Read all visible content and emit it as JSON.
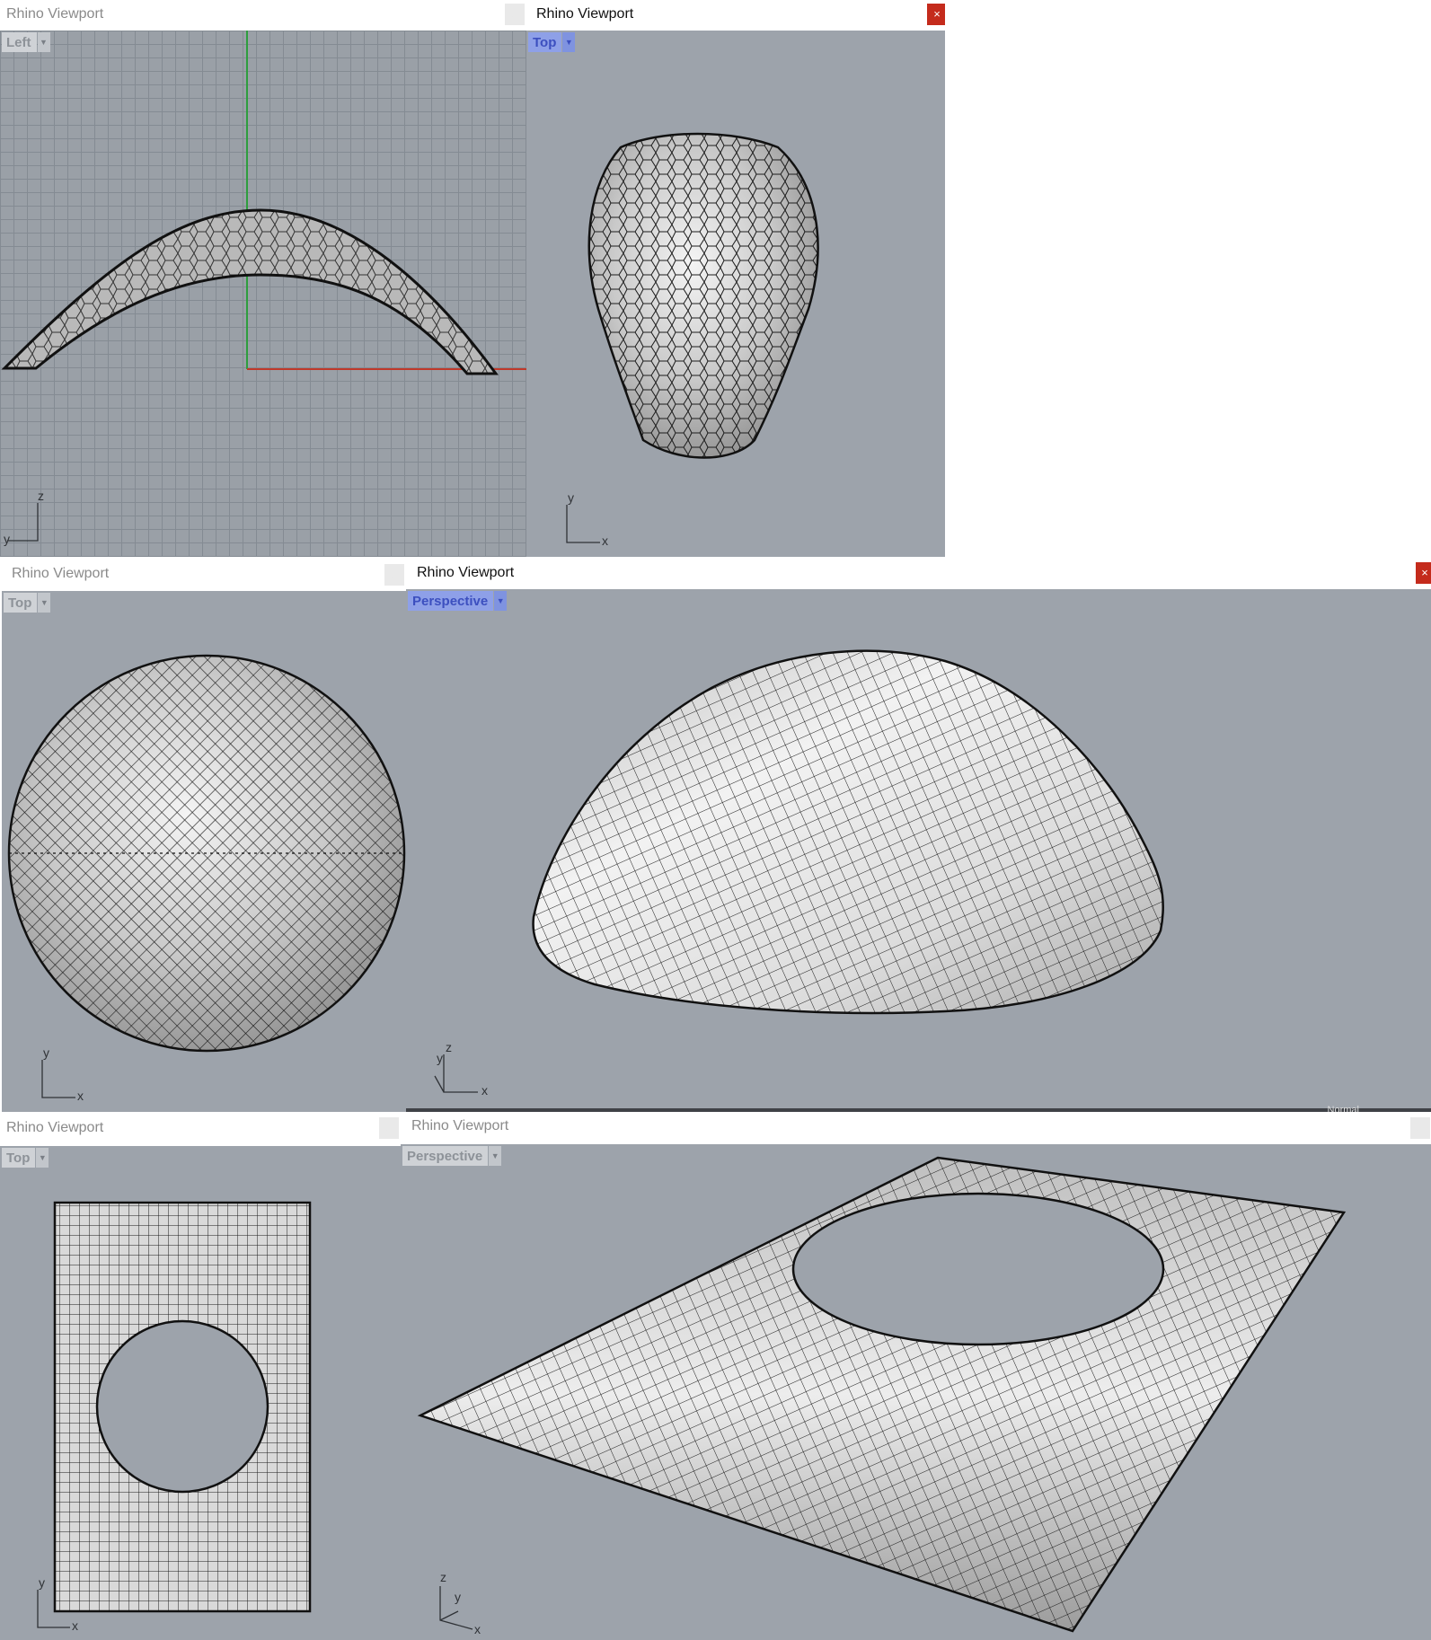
{
  "windows": [
    {
      "title": "Rhino Viewport",
      "view": "Left",
      "active": false,
      "axis": [
        "z",
        "y"
      ]
    },
    {
      "title": "Rhino Viewport",
      "view": "Top",
      "active": true,
      "axis": [
        "y",
        "x"
      ]
    },
    {
      "title": "Rhino Viewport",
      "view": "Top",
      "active": false,
      "axis": [
        "y",
        "x"
      ]
    },
    {
      "title": "Rhino Viewport",
      "view": "Perspective",
      "active": true,
      "axis": [
        "z",
        "y",
        "x"
      ],
      "display_mode": "Normal"
    },
    {
      "title": "Rhino Viewport",
      "view": "Top",
      "active": false,
      "axis": [
        "y",
        "x"
      ]
    },
    {
      "title": "Rhino Viewport",
      "view": "Perspective",
      "active": false,
      "axis": [
        "z",
        "y",
        "x"
      ]
    }
  ],
  "icons": {
    "close": "close-icon",
    "dropdown": "chevron-down-icon"
  },
  "close_glyph": "×",
  "dropdown_glyph": "▼",
  "colors": {
    "viewport_bg": "#9da3ab",
    "active_label_bg": "#8ea0e8",
    "active_label_text": "#3c4fbf",
    "close_active": "#c42b1c",
    "axis_x": "#c0392b",
    "axis_y": "#2e9e3e",
    "mesh_edge": "#1a1a1a"
  }
}
